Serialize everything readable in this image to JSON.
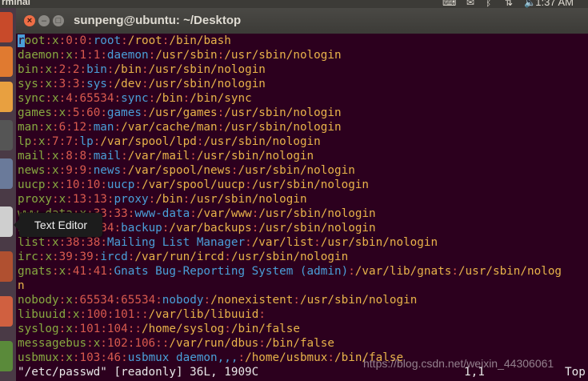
{
  "topbar": {
    "app_name": "rminal",
    "time": "1:37 AM"
  },
  "window": {
    "title": "sunpeng@ubuntu: ~/Desktop"
  },
  "tooltip": {
    "label": "Text Editor"
  },
  "lines": [
    {
      "user": "root",
      "pw": "x",
      "uid": "0",
      "gid": "0",
      "gecos": "root",
      "home": "/root",
      "shell": "/bin/bash"
    },
    {
      "user": "daemon",
      "pw": "x",
      "uid": "1",
      "gid": "1",
      "gecos": "daemon",
      "home": "/usr/sbin",
      "shell": "/usr/sbin/nologin"
    },
    {
      "user": "bin",
      "pw": "x",
      "uid": "2",
      "gid": "2",
      "gecos": "bin",
      "home": "/bin",
      "shell": "/usr/sbin/nologin"
    },
    {
      "user": "sys",
      "pw": "x",
      "uid": "3",
      "gid": "3",
      "gecos": "sys",
      "home": "/dev",
      "shell": "/usr/sbin/nologin"
    },
    {
      "user": "sync",
      "pw": "x",
      "uid": "4",
      "gid": "65534",
      "gecos": "sync",
      "home": "/bin",
      "shell": "/bin/sync"
    },
    {
      "user": "games",
      "pw": "x",
      "uid": "5",
      "gid": "60",
      "gecos": "games",
      "home": "/usr/games",
      "shell": "/usr/sbin/nologin"
    },
    {
      "user": "man",
      "pw": "x",
      "uid": "6",
      "gid": "12",
      "gecos": "man",
      "home": "/var/cache/man",
      "shell": "/usr/sbin/nologin"
    },
    {
      "user": "lp",
      "pw": "x",
      "uid": "7",
      "gid": "7",
      "gecos": "lp",
      "home": "/var/spool/lpd",
      "shell": "/usr/sbin/nologin"
    },
    {
      "user": "mail",
      "pw": "x",
      "uid": "8",
      "gid": "8",
      "gecos": "mail",
      "home": "/var/mail",
      "shell": "/usr/sbin/nologin"
    },
    {
      "user": "news",
      "pw": "x",
      "uid": "9",
      "gid": "9",
      "gecos": "news",
      "home": "/var/spool/news",
      "shell": "/usr/sbin/nologin"
    },
    {
      "user": "uucp",
      "pw": "x",
      "uid": "10",
      "gid": "10",
      "gecos": "uucp",
      "home": "/var/spool/uucp",
      "shell": "/usr/sbin/nologin"
    },
    {
      "user": "proxy",
      "pw": "x",
      "uid": "13",
      "gid": "13",
      "gecos": "proxy",
      "home": "/bin",
      "shell": "/usr/sbin/nologin"
    },
    {
      "user": "www-data",
      "pw": "x",
      "uid": "33",
      "gid": "33",
      "gecos": "www-data",
      "home": "/var/www",
      "shell": "/usr/sbin/nologin"
    },
    {
      "user": "backup",
      "pw": "x",
      "uid": "34",
      "gid": "34",
      "gecos": "backup",
      "home": "/var/backups",
      "shell": "/usr/sbin/nologin"
    },
    {
      "user": "list",
      "pw": "x",
      "uid": "38",
      "gid": "38",
      "gecos": "Mailing List Manager",
      "home": "/var/list",
      "shell": "/usr/sbin/nologin"
    },
    {
      "user": "irc",
      "pw": "x",
      "uid": "39",
      "gid": "39",
      "gecos": "ircd",
      "home": "/var/run/ircd",
      "shell": "/usr/sbin/nologin"
    },
    {
      "user": "gnats",
      "pw": "x",
      "uid": "41",
      "gid": "41",
      "gecos": "Gnats Bug-Reporting System (admin)",
      "home": "/var/lib/gnats",
      "shell": "/usr/sbin/nolog"
    },
    {
      "wrap": "n"
    },
    {
      "user": "nobody",
      "pw": "x",
      "uid": "65534",
      "gid": "65534",
      "gecos": "nobody",
      "home": "/nonexistent",
      "shell": "/usr/sbin/nologin"
    },
    {
      "user": "libuuid",
      "pw": "x",
      "uid": "100",
      "gid": "101",
      "gecos": "",
      "home": "/var/lib/libuuid",
      "shell": ""
    },
    {
      "user": "syslog",
      "pw": "x",
      "uid": "101",
      "gid": "104",
      "gecos": "",
      "home": "/home/syslog",
      "shell": "/bin/false"
    },
    {
      "user": "messagebus",
      "pw": "x",
      "uid": "102",
      "gid": "106",
      "gecos": "",
      "home": "/var/run/dbus",
      "shell": "/bin/false"
    },
    {
      "user": "usbmux",
      "pw": "x",
      "uid": "103",
      "gid": "46",
      "gecos": "usbmux daemon,,,",
      "home": "/home/usbmux",
      "shell": "/bin/false"
    }
  ],
  "status": {
    "file": "\"/etc/passwd\" [readonly] 36L, 1909C",
    "position": "1,1",
    "scroll": "Top"
  },
  "watermark": "https://blog.csdn.net/weixin_44306061",
  "colors": {
    "background": "#2c001e",
    "user": "#87a940",
    "separator": "#d85a4e",
    "gecos": "#4a9fd8",
    "path": "#e8b34a"
  }
}
